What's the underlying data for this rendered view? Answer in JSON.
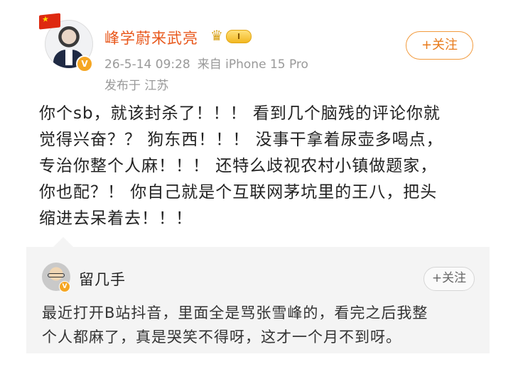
{
  "post": {
    "author": {
      "username": "峰学蔚来武亮",
      "vip_level": "I",
      "verified_badge": "V",
      "avatar_icon": "avatar-icon",
      "flag_icon": "china-flag-icon"
    },
    "timestamp": "26-5-14 09:28",
    "source": "来自 iPhone 15 Pro",
    "location": "发布于 江苏",
    "follow_label": "+关注",
    "text_lines": [
      "你个sb，就该封杀了！！！ 看到几个脑残的评论你就",
      "觉得兴奋？？ 狗东西！！！ 没事干拿着尿壶多喝点，",
      "专治你整个人麻！！！ 还特么歧视农村小镇做题家，",
      "你也配？！ 你自己就是个互联网茅坑里的王八，把头",
      "缩进去呆着去！！！"
    ]
  },
  "quoted": {
    "username": "留几手",
    "verified_badge": "V",
    "follow_label": "+关注",
    "text_lines": [
      "最近打开B站抖音，里面全是骂张雪峰的，看完之后我整",
      "个人都麻了，真是哭笑不得呀，这才一个月不到呀。"
    ]
  },
  "colors": {
    "username": "#e8581c",
    "follow_accent": "#e87a1a",
    "meta_gray": "#999999",
    "quote_bg": "#f4f4f4"
  }
}
